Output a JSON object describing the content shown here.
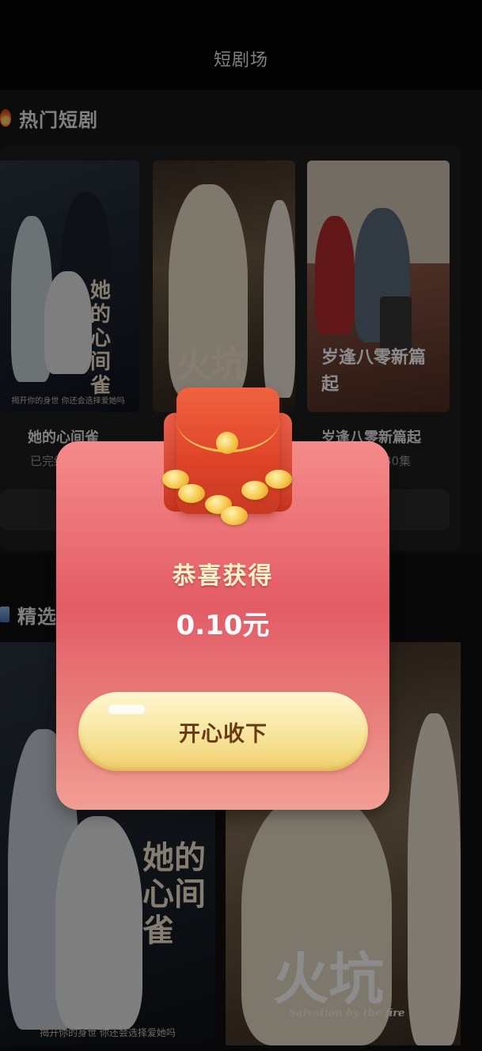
{
  "header": {
    "title": "短剧场"
  },
  "hot_section": {
    "title": "热门短剧",
    "icon": "fire-icon",
    "items": [
      {
        "name": "她的心间雀",
        "meta": "已完结",
        "poster_text": "她的心间雀",
        "poster_tagline": "揭开你的身世  你还会选择爱她吗"
      },
      {
        "name": "火坑",
        "meta": "",
        "poster_text": "火坑"
      },
      {
        "name": "岁逢八零新篇起",
        "meta": "共80集",
        "poster_text": "岁逢八零新篇起"
      }
    ]
  },
  "selected_section": {
    "title": "精选",
    "icon": "film-icon",
    "items": [
      {
        "poster_text": "她的心间雀",
        "poster_tagline": "揭开你的身世  你还会选择爱她吗"
      },
      {
        "poster_text": "火坑",
        "poster_subtitle": "Salvation by the fire"
      }
    ]
  },
  "reward_modal": {
    "title": "恭喜获得",
    "amount": "0.10元",
    "button_label": "开心收下",
    "icon": "red-envelope-icon"
  }
}
